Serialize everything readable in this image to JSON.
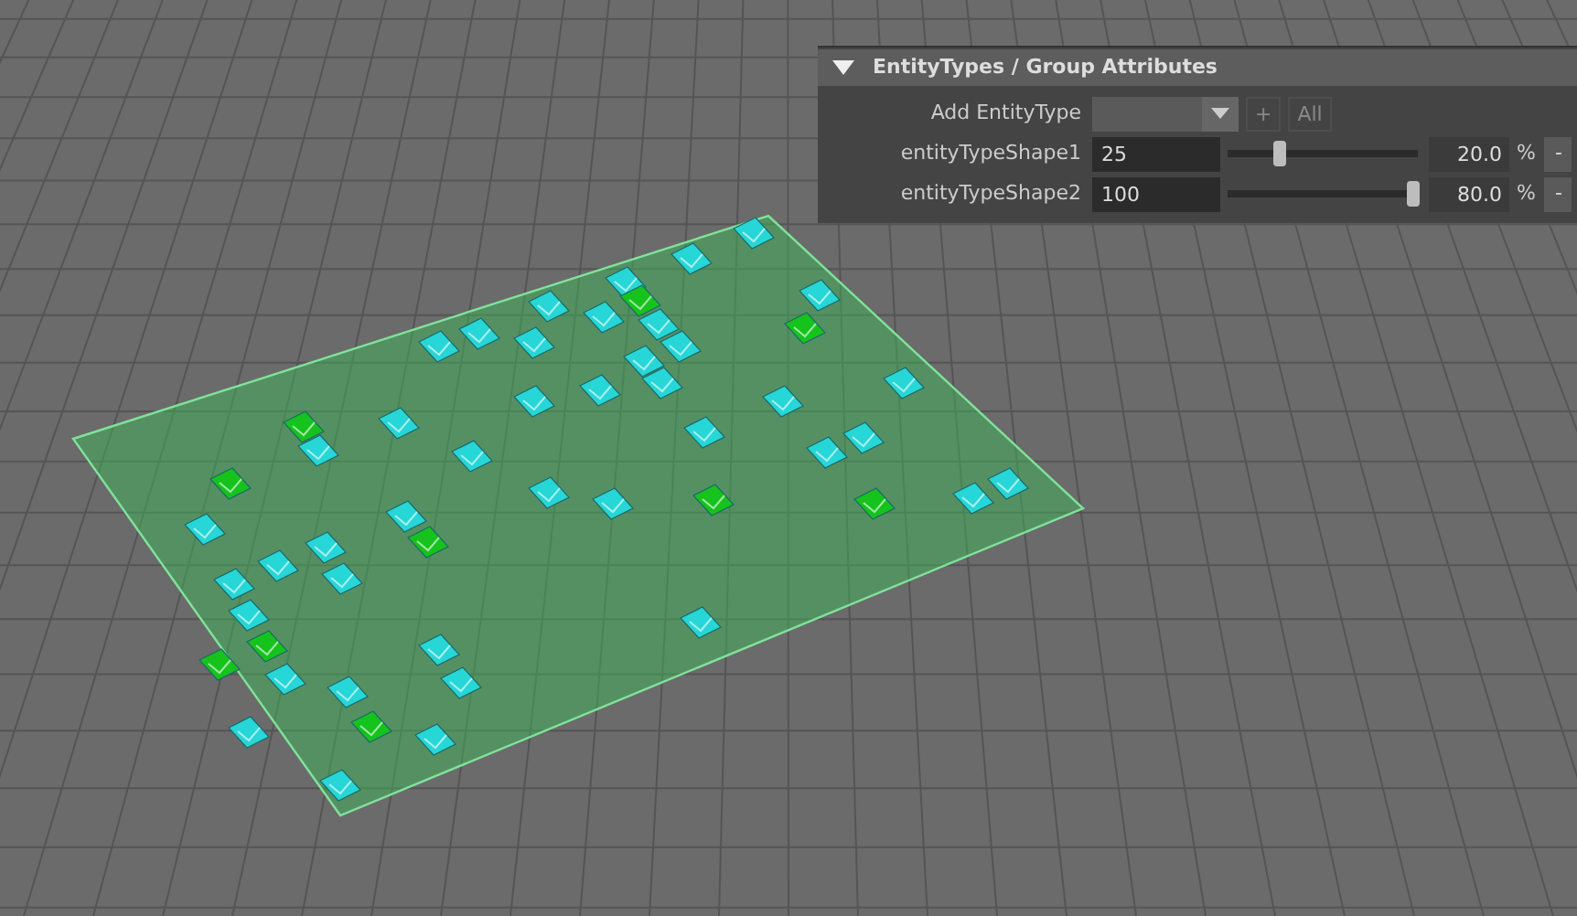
{
  "panel": {
    "title": "EntityTypes / Group Attributes",
    "expanded": true,
    "add_row": {
      "label": "Add EntityType",
      "add_button": {
        "text": "+",
        "disabled": true
      },
      "all_button": {
        "text": "All",
        "disabled": true
      }
    },
    "entity_types": [
      {
        "name": "entityTypeShape1",
        "value": "25",
        "level": 0.25,
        "percent": "20.0",
        "unit": "%",
        "remove": "-"
      },
      {
        "name": "entityTypeShape2",
        "value": "100",
        "level": 1,
        "percent": "80.0",
        "unit": "%",
        "remove": "-"
      }
    ]
  }
}
